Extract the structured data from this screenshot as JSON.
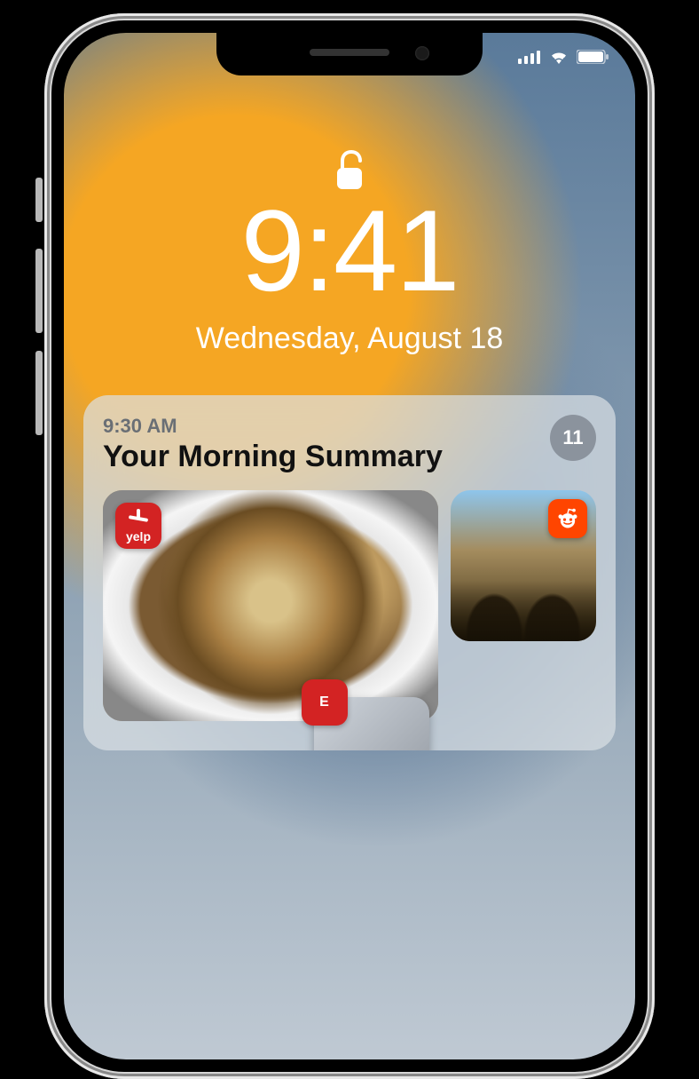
{
  "status": {
    "cellular_bars": 4,
    "wifi": true,
    "battery_full": true
  },
  "lock": {
    "state": "unlocked"
  },
  "clock": {
    "time": "9:41",
    "date": "Wednesday, August 18"
  },
  "summary": {
    "timestamp": "9:30 AM",
    "title": "Your Morning Summary",
    "count": "11",
    "items": [
      {
        "app": "yelp",
        "app_label": "yelp"
      },
      {
        "app": "reddit",
        "app_label": ""
      },
      {
        "app": "espn",
        "app_label": "E"
      }
    ]
  }
}
